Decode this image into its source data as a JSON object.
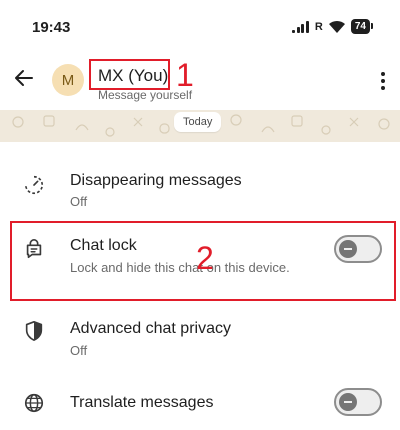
{
  "status_bar": {
    "time": "19:43",
    "network_letter": "R",
    "battery": "74",
    "icons": [
      "signal-icon",
      "wifi-icon",
      "battery-icon"
    ]
  },
  "header": {
    "avatar_letter": "M",
    "name": "MX (You)",
    "subtitle": "Message yourself",
    "back_icon": "arrow-left-icon",
    "menu_icon": "more-vert-icon"
  },
  "chat": {
    "date_chip": "Today"
  },
  "settings": [
    {
      "icon": "timer-icon",
      "title": "Disappearing messages",
      "subtitle": "Off"
    },
    {
      "icon": "chat-lock-icon",
      "title": "Chat lock",
      "subtitle": "Lock and hide this chat on this device.",
      "toggle_on": false
    },
    {
      "icon": "shield-icon",
      "title": "Advanced chat privacy",
      "subtitle": "Off"
    },
    {
      "icon": "globe-icon",
      "title": "Translate messages",
      "toggle_on": false
    }
  ],
  "annotations": {
    "label_1": "1",
    "label_2": "2",
    "color": "#e11d2a"
  },
  "colors": {
    "accent_annotation": "#e11d2a",
    "avatar_bg": "#f6dfb3",
    "chat_wallpaper": "#f0e9dc"
  }
}
